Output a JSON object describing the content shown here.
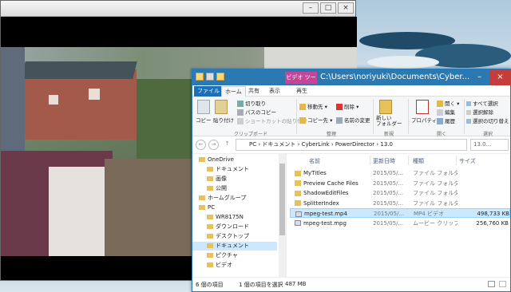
{
  "explorer": {
    "title": "C:\\Users\\noriyuki\\Documents\\Cyber...",
    "contextual_tab": "ビデオ ツール",
    "tabs": [
      {
        "label": "ファイル"
      },
      {
        "label": "ホーム"
      },
      {
        "label": "共有"
      },
      {
        "label": "表示"
      },
      {
        "label": "再生"
      }
    ],
    "ribbon": {
      "copy": "コピー",
      "paste": "貼り付け",
      "cut": "切り取り",
      "copy_path": "パスのコピー",
      "paste_shortcut": "ショートカットの貼り付け",
      "clipboard_group": "クリップボード",
      "move_to": "移動先",
      "copy_to": "コピー先",
      "delete": "削除",
      "rename": "名前の変更",
      "organize_group": "整理",
      "new_folder": "新しい\nフォルダー",
      "new_group": "新規",
      "properties": "プロパティ",
      "open": "開く",
      "edit": "編集",
      "history": "履歴",
      "open_group": "開く",
      "select_all": "すべて選択",
      "select_none": "選択解除",
      "invert_selection": "選択の切り替え",
      "select_group": "選択"
    },
    "address": {
      "crumbs": [
        "PC",
        "ドキュメント",
        "CyberLink",
        "PowerDirector",
        "13.0"
      ],
      "search_placeholder": "13.0..."
    },
    "nav": [
      {
        "label": "OneDrive",
        "indent": 0
      },
      {
        "label": "ドキュメント",
        "indent": 1
      },
      {
        "label": "画像",
        "indent": 1
      },
      {
        "label": "公開",
        "indent": 1
      },
      {
        "label": "ホームグループ",
        "indent": 0
      },
      {
        "label": "PC",
        "indent": 0
      },
      {
        "label": "WR8175N",
        "indent": 1
      },
      {
        "label": "ダウンロード",
        "indent": 1
      },
      {
        "label": "デスクトップ",
        "indent": 1
      },
      {
        "label": "ドキュメント",
        "indent": 1,
        "selected": true
      },
      {
        "label": "ピクチャ",
        "indent": 1
      },
      {
        "label": "ビデオ",
        "indent": 1
      }
    ],
    "columns": {
      "name": "名前",
      "date": "更新日時",
      "type": "種類",
      "size": "サイズ"
    },
    "files": [
      {
        "name": "MyTitles",
        "date": "2015/05/...",
        "type": "ファイル フォルダー",
        "size": "",
        "kind": "folder"
      },
      {
        "name": "Preview Cache Files",
        "date": "2015/05/...",
        "type": "ファイル フォルダー",
        "size": "",
        "kind": "folder"
      },
      {
        "name": "ShadowEditFiles",
        "date": "2015/05/...",
        "type": "ファイル フォルダー",
        "size": "",
        "kind": "folder"
      },
      {
        "name": "SplitterIndex",
        "date": "2015/05/...",
        "type": "ファイル フォルダー",
        "size": "",
        "kind": "folder"
      },
      {
        "name": "mpeg-test.mp4",
        "date": "2015/05/...",
        "type": "MP4 ビデオ",
        "size": "498,733 KB",
        "kind": "video",
        "selected": true
      },
      {
        "name": "mpeg-test.mpg",
        "date": "2015/05/...",
        "type": "ムービー クリップ",
        "size": "256,760 KB",
        "kind": "video"
      }
    ],
    "status": {
      "item_count": "6 個の項目",
      "selection": "1 個の項目を選択",
      "selection_size": "487 MB"
    }
  },
  "colors": {
    "accent": "#2b79b3",
    "file_tab": "#1d6fb8",
    "video_tools": "#c2479b",
    "selection": "#cce8ff"
  }
}
